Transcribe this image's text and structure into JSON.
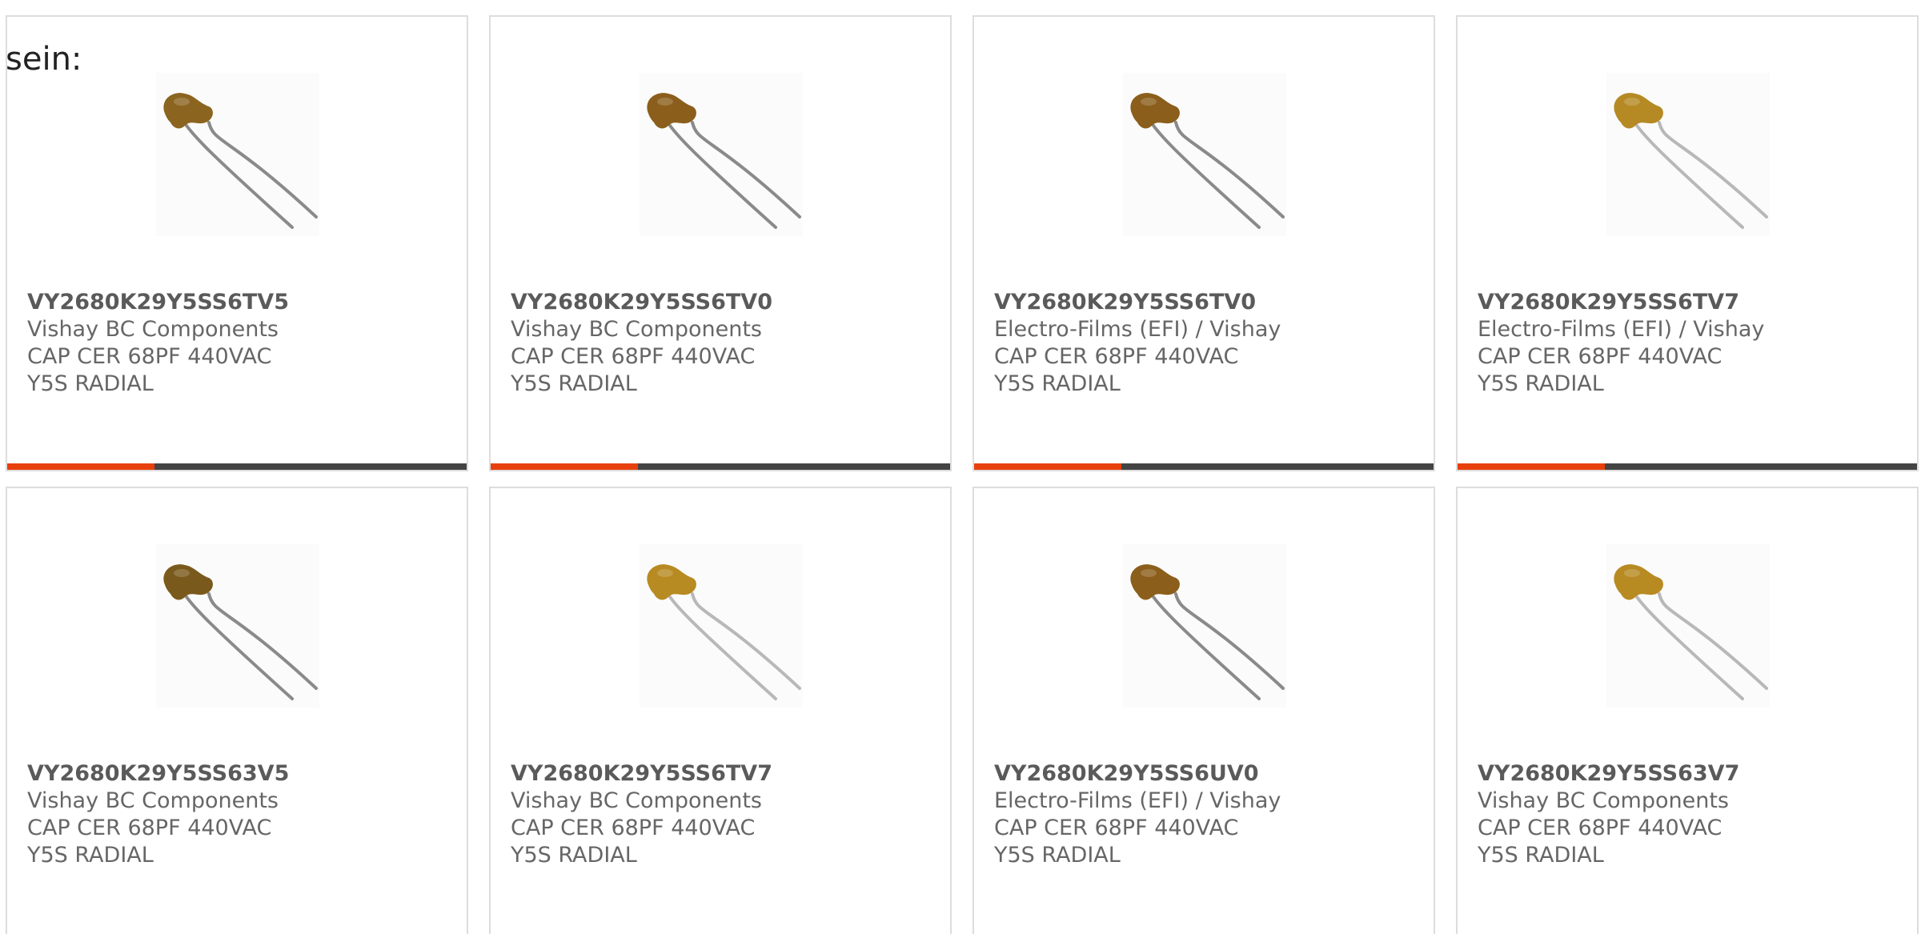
{
  "intro_text": "sein:",
  "accent_color": "#e8400c",
  "track_color": "#444444",
  "cards": [
    {
      "part": "VY2680K29Y5SS6TV5",
      "manufacturer": "Vishay BC Components",
      "description": "CAP CER 68PF 440VAC Y5S RADIAL",
      "bar_fraction": 0.32,
      "cap_color": "#8b6420",
      "lead_color": "#8a8a8a"
    },
    {
      "part": "VY2680K29Y5SS6TV0",
      "manufacturer": "Vishay BC Components",
      "description": "CAP CER 68PF 440VAC Y5S RADIAL",
      "bar_fraction": 0.32,
      "cap_color": "#8b5e1c",
      "lead_color": "#8a8a8a"
    },
    {
      "part": "VY2680K29Y5SS6TV0",
      "manufacturer": "Electro-Films (EFI) / Vishay",
      "description": "CAP CER 68PF 440VAC Y5S RADIAL",
      "bar_fraction": 0.32,
      "cap_color": "#8b5e1c",
      "lead_color": "#8a8a8a"
    },
    {
      "part": "VY2680K29Y5SS6TV7",
      "manufacturer": "Electro-Films (EFI) / Vishay",
      "description": "CAP CER 68PF 440VAC Y5S RADIAL",
      "bar_fraction": 0.32,
      "cap_color": "#b58a24",
      "lead_color": "#b8b8b8"
    },
    {
      "part": "VY2680K29Y5SS63V5",
      "manufacturer": "Vishay BC Components",
      "description": "CAP CER 68PF 440VAC Y5S RADIAL",
      "bar_fraction": null,
      "cap_color": "#7a5a1c",
      "lead_color": "#8a8a8a"
    },
    {
      "part": "VY2680K29Y5SS6TV7",
      "manufacturer": "Vishay BC Components",
      "description": "CAP CER 68PF 440VAC Y5S RADIAL",
      "bar_fraction": null,
      "cap_color": "#b88a22",
      "lead_color": "#b8b8b8"
    },
    {
      "part": "VY2680K29Y5SS6UV0",
      "manufacturer": "Electro-Films (EFI) / Vishay",
      "description": "CAP CER 68PF 440VAC Y5S RADIAL",
      "bar_fraction": null,
      "cap_color": "#8b5e1c",
      "lead_color": "#8a8a8a"
    },
    {
      "part": "VY2680K29Y5SS63V7",
      "manufacturer": "Vishay BC Components",
      "description": "CAP CER 68PF 440VAC Y5S RADIAL",
      "bar_fraction": null,
      "cap_color": "#b88a22",
      "lead_color": "#b8b8b8"
    }
  ]
}
